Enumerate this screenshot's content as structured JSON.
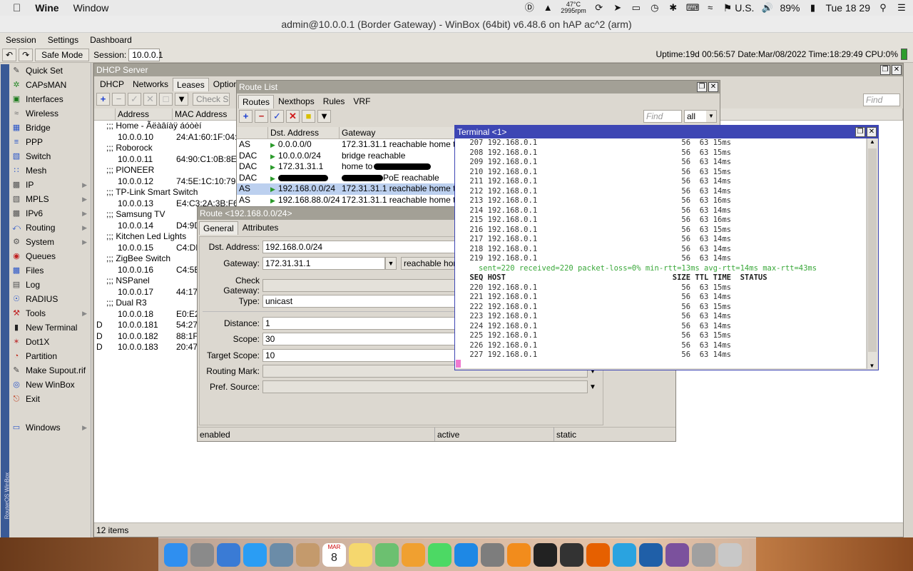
{
  "menubar": {
    "app": "Wine",
    "items": [
      "Window"
    ],
    "temp": "47°C",
    "rpm": "2995rpm",
    "input_source": "U.S.",
    "battery": "89%",
    "clock": "Tue 18 29"
  },
  "window_title": "admin@10.0.0.1 (Border Gateway) - WinBox (64bit) v6.48.6 on hAP ac^2 (arm)",
  "winbox_menu": [
    "Session",
    "Settings",
    "Dashboard"
  ],
  "toolbar": {
    "safe_mode": "Safe Mode",
    "session_label": "Session:",
    "session_value": "10.0.0.1",
    "status": "Uptime:19d 00:56:57 Date:Mar/08/2022 Time:18:29:49 CPU:0%"
  },
  "sidebar": {
    "vertical_label": "RouterOS WinBox",
    "items": [
      {
        "label": "Quick Set",
        "icon": "wand-icon"
      },
      {
        "label": "CAPsMAN",
        "icon": "antenna-icon"
      },
      {
        "label": "Interfaces",
        "icon": "interfaces-icon"
      },
      {
        "label": "Wireless",
        "icon": "wireless-icon"
      },
      {
        "label": "Bridge",
        "icon": "bridge-icon"
      },
      {
        "label": "PPP",
        "icon": "ppp-icon"
      },
      {
        "label": "Switch",
        "icon": "switch-icon"
      },
      {
        "label": "Mesh",
        "icon": "mesh-icon"
      },
      {
        "label": "IP",
        "icon": "ip-icon",
        "sub": true
      },
      {
        "label": "MPLS",
        "icon": "mpls-icon",
        "sub": true
      },
      {
        "label": "IPv6",
        "icon": "ipv6-icon",
        "sub": true
      },
      {
        "label": "Routing",
        "icon": "routing-icon",
        "sub": true
      },
      {
        "label": "System",
        "icon": "system-icon",
        "sub": true
      },
      {
        "label": "Queues",
        "icon": "queues-icon"
      },
      {
        "label": "Files",
        "icon": "files-icon"
      },
      {
        "label": "Log",
        "icon": "log-icon"
      },
      {
        "label": "RADIUS",
        "icon": "radius-icon"
      },
      {
        "label": "Tools",
        "icon": "tools-icon",
        "sub": true
      },
      {
        "label": "New Terminal",
        "icon": "terminal-icon"
      },
      {
        "label": "Dot1X",
        "icon": "dot1x-icon"
      },
      {
        "label": "Partition",
        "icon": "partition-icon"
      },
      {
        "label": "Make Supout.rif",
        "icon": "supout-icon"
      },
      {
        "label": "New WinBox",
        "icon": "winbox-icon"
      },
      {
        "label": "Exit",
        "icon": "exit-icon"
      },
      {
        "label": "Windows",
        "icon": "windows-icon",
        "sub": true
      }
    ]
  },
  "dhcp": {
    "title": "DHCP Server",
    "tabs": [
      "DHCP",
      "Networks",
      "Leases",
      "Options",
      "Op"
    ],
    "check_status": "Check Sta",
    "find_placeholder": "Find",
    "columns": [
      "Address",
      "MAC Address"
    ],
    "rows": [
      {
        "flag": "",
        "address": ";;; Home - Ãëàâíàÿ áóòèí",
        "mac": "",
        "comment": true
      },
      {
        "flag": "",
        "address": "10.0.0.10",
        "mac": "24:A1:60:1F:04:7"
      },
      {
        "flag": "",
        "address": ";;; Roborock",
        "mac": "",
        "comment": true
      },
      {
        "flag": "",
        "address": "10.0.0.11",
        "mac": "64:90:C1:0B:8E:3"
      },
      {
        "flag": "",
        "address": ";;; PIONEER",
        "mac": "",
        "comment": true
      },
      {
        "flag": "",
        "address": "10.0.0.12",
        "mac": "74:5E:1C:10:79:1"
      },
      {
        "flag": "",
        "address": ";;; TP-Link Smart Switch",
        "mac": "",
        "comment": true
      },
      {
        "flag": "",
        "address": "10.0.0.13",
        "mac": "E4:C3:2A:3B:F6:8"
      },
      {
        "flag": "",
        "address": ";;; Samsung TV",
        "mac": "",
        "comment": true
      },
      {
        "flag": "",
        "address": "10.0.0.14",
        "mac": "D4:9D"
      },
      {
        "flag": "",
        "address": ";;; Kitchen Led Lights",
        "mac": "",
        "comment": true
      },
      {
        "flag": "",
        "address": "10.0.0.15",
        "mac": "C4:DD"
      },
      {
        "flag": "",
        "address": ";;; ZigBee Switch",
        "mac": "",
        "comment": true
      },
      {
        "flag": "",
        "address": "10.0.0.16",
        "mac": "C4:5B:"
      },
      {
        "flag": "",
        "address": ";;; NSPanel",
        "mac": "",
        "comment": true
      },
      {
        "flag": "",
        "address": "10.0.0.17",
        "mac": "44:17:"
      },
      {
        "flag": "",
        "address": ";;; Dual R3",
        "mac": "",
        "comment": true
      },
      {
        "flag": "",
        "address": "10.0.0.18",
        "mac": "E0:E2:"
      },
      {
        "flag": "D",
        "address": "10.0.0.181",
        "mac": "54:27:"
      },
      {
        "flag": "D",
        "address": "10.0.0.182",
        "mac": "88:1F:"
      },
      {
        "flag": "D",
        "address": "10.0.0.183",
        "mac": "20:47:"
      }
    ],
    "footer": "12 items"
  },
  "route_list": {
    "title": "Route List",
    "tabs": [
      "Routes",
      "Nexthops",
      "Rules",
      "VRF"
    ],
    "find_placeholder": "Find",
    "filter_value": "all",
    "columns": [
      "Dst. Address",
      "Gateway"
    ],
    "rows": [
      {
        "flag": "AS",
        "dst": "0.0.0.0/0",
        "gw": "172.31.31.1 reachable home to a"
      },
      {
        "flag": "DAC",
        "dst": "10.0.0.0/24",
        "gw": "bridge reachable"
      },
      {
        "flag": "DAC",
        "dst": "172.31.31.1",
        "gw": "home to"
      },
      {
        "flag": "DAC",
        "dst": "",
        "gw": "PoE reachable"
      },
      {
        "flag": "AS",
        "dst": "192.168.0.0/24",
        "gw": "172.31.31.1 reachable home to a",
        "sel": true
      },
      {
        "flag": "AS",
        "dst": "192.168.88.0/24",
        "gw": "172.31.31.1 reachable home to a"
      }
    ]
  },
  "route_edit": {
    "title": "Route <192.168.0.0/24>",
    "tabs": [
      "General",
      "Attributes"
    ],
    "fields": {
      "dst_label": "Dst. Address:",
      "dst": "192.168.0.0/24",
      "gw_label": "Gateway:",
      "gw": "172.31.31.1",
      "gw_state": "reachable home",
      "check_label": "Check Gateway:",
      "type_label": "Type:",
      "type": "unicast",
      "distance_label": "Distance:",
      "distance": "1",
      "scope_label": "Scope:",
      "scope": "30",
      "tscope_label": "Target Scope:",
      "tscope": "10",
      "mark_label": "Routing Mark:",
      "pref_label": "Pref. Source:"
    },
    "status": [
      "enabled",
      "active",
      "static"
    ]
  },
  "terminal": {
    "title": "Terminal <1>",
    "lines": [
      {
        "t": " 207 192.168.0.1                                56  63 15ms"
      },
      {
        "t": " 208 192.168.0.1                                56  63 15ms"
      },
      {
        "t": " 209 192.168.0.1                                56  63 14ms"
      },
      {
        "t": " 210 192.168.0.1                                56  63 15ms"
      },
      {
        "t": " 211 192.168.0.1                                56  63 14ms"
      },
      {
        "t": " 212 192.168.0.1                                56  63 14ms"
      },
      {
        "t": " 213 192.168.0.1                                56  63 16ms"
      },
      {
        "t": " 214 192.168.0.1                                56  63 14ms"
      },
      {
        "t": " 215 192.168.0.1                                56  63 16ms"
      },
      {
        "t": " 216 192.168.0.1                                56  63 15ms"
      },
      {
        "t": " 217 192.168.0.1                                56  63 14ms"
      },
      {
        "t": " 218 192.168.0.1                                56  63 14ms"
      },
      {
        "t": " 219 192.168.0.1                                56  63 14ms"
      },
      {
        "t": "   sent=220 received=220 packet-loss=0% min-rtt=13ms avg-rtt=14ms max-rtt=43ms",
        "c": "g"
      },
      {
        "t": " SEQ HOST                                     SIZE TTL TIME  STATUS",
        "c": "b"
      },
      {
        "t": " 220 192.168.0.1                                56  63 15ms"
      },
      {
        "t": " 221 192.168.0.1                                56  63 14ms"
      },
      {
        "t": " 222 192.168.0.1                                56  63 15ms"
      },
      {
        "t": " 223 192.168.0.1                                56  63 14ms"
      },
      {
        "t": " 224 192.168.0.1                                56  63 14ms"
      },
      {
        "t": " 225 192.168.0.1                                56  63 15ms"
      },
      {
        "t": " 226 192.168.0.1                                56  63 14ms"
      },
      {
        "t": " 227 192.168.0.1                                56  63 14ms"
      }
    ]
  },
  "dock": {
    "calendar_month": "MAR",
    "calendar_day": "8",
    "apps": [
      {
        "name": "finder-icon",
        "color": "#2f8ff0"
      },
      {
        "name": "launchpad-icon",
        "color": "#8a8a8a"
      },
      {
        "name": "wine-icon",
        "color": "#3a7bd5"
      },
      {
        "name": "safari-icon",
        "color": "#2a9df4"
      },
      {
        "name": "preview-icon",
        "color": "#6b8ca8"
      },
      {
        "name": "contacts-icon",
        "color": "#c49a6c"
      },
      {
        "name": "calendar-icon",
        "color": "#ffffff"
      },
      {
        "name": "notes-icon",
        "color": "#f5d76e"
      },
      {
        "name": "maps-icon",
        "color": "#6cc070"
      },
      {
        "name": "photos-icon",
        "color": "#f0a030"
      },
      {
        "name": "messages-icon",
        "color": "#4cd964"
      },
      {
        "name": "appstore-icon",
        "color": "#1e88e5"
      },
      {
        "name": "system-preferences-icon",
        "color": "#7d7d7d"
      },
      {
        "name": "vlc-icon",
        "color": "#f28c1c"
      },
      {
        "name": "terminal-app-icon",
        "color": "#222222"
      },
      {
        "name": "activity-monitor-icon",
        "color": "#333333"
      },
      {
        "name": "firefox-icon",
        "color": "#e66000"
      },
      {
        "name": "telegram-icon",
        "color": "#2aa3e0"
      },
      {
        "name": "winbox-dock-icon",
        "color": "#1f5fa8"
      },
      {
        "name": "viber-icon",
        "color": "#7b519d"
      },
      {
        "name": "preview2-icon",
        "color": "#a0a0a0"
      },
      {
        "name": "trash-icon",
        "color": "#c8c8c8"
      }
    ]
  }
}
